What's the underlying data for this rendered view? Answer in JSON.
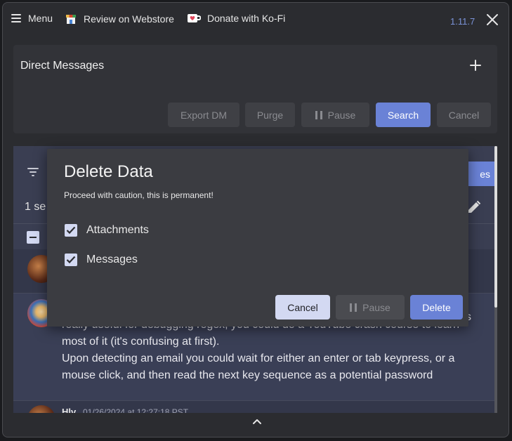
{
  "topbar": {
    "menu_label": "Menu",
    "webstore_label": "Review on Webstore",
    "kofi_label": "Donate with Ko-Fi",
    "version": "1.11.7"
  },
  "dm_panel": {
    "title": "Direct Messages",
    "buttons": {
      "export": "Export DM",
      "purge": "Purge",
      "pause": "Pause",
      "search": "Search",
      "cancel": "Cancel"
    }
  },
  "messages": {
    "selected_text": "1 se",
    "right_button_text": "es",
    "message_lines": [
      "really useful for debugging regex, you could do a YouTube crash course to learn",
      "most of it (it's confusing at first).",
      "Upon detecting an email you could wait for either an enter or tab keypress, or a",
      "mouse click, and then read the next key sequence as a potential password"
    ],
    "partial_line_right": "s",
    "last_author": "Hlv",
    "last_timestamp": "01/26/2024 at 12:27:18 PST"
  },
  "dialog": {
    "title": "Delete Data",
    "subtitle": "Proceed with caution, this is permanent!",
    "options": [
      {
        "label": "Attachments",
        "checked": true
      },
      {
        "label": "Messages",
        "checked": true
      }
    ],
    "buttons": {
      "cancel": "Cancel",
      "pause": "Pause",
      "delete": "Delete"
    }
  },
  "colors": {
    "accent": "#6a82d6",
    "light_button": "#d3d9f2",
    "version": "#7b93d8"
  }
}
